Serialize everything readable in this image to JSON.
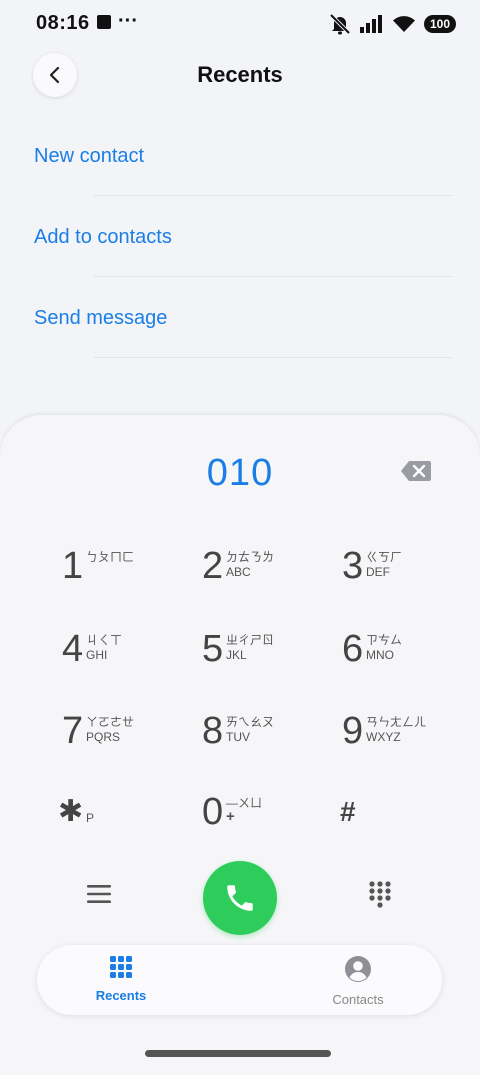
{
  "status_bar": {
    "time": "08:16",
    "more": "···",
    "battery": "100"
  },
  "header": {
    "title": "Recents"
  },
  "actions": [
    {
      "label": "New contact"
    },
    {
      "label": "Add to contacts"
    },
    {
      "label": "Send message"
    }
  ],
  "dialer": {
    "number": "010",
    "keys": [
      {
        "digit": "1",
        "zhuyin": "ㄅㄆㄇㄈ",
        "letters": ""
      },
      {
        "digit": "2",
        "zhuyin": "ㄉㄊㄋㄌ",
        "letters": "ABC"
      },
      {
        "digit": "3",
        "zhuyin": "ㄍㄎㄏ",
        "letters": "DEF"
      },
      {
        "digit": "4",
        "zhuyin": "ㄐㄑㄒ",
        "letters": "GHI"
      },
      {
        "digit": "5",
        "zhuyin": "ㄓㄔㄕㄖ",
        "letters": "JKL"
      },
      {
        "digit": "6",
        "zhuyin": "ㄗㄘㄙ",
        "letters": "MNO"
      },
      {
        "digit": "7",
        "zhuyin": "ㄚㄛㄜㄝ",
        "letters": "PQRS"
      },
      {
        "digit": "8",
        "zhuyin": "ㄞㄟㄠㄡ",
        "letters": "TUV"
      },
      {
        "digit": "9",
        "zhuyin": "ㄢㄣㄤㄥㄦ",
        "letters": "WXYZ"
      },
      {
        "digit": "✱",
        "zhuyin": "",
        "letters": "P"
      },
      {
        "digit": "0",
        "zhuyin": "—ㄨㄩ",
        "letters": "+"
      },
      {
        "digit": "#",
        "zhuyin": "",
        "letters": ""
      }
    ]
  },
  "bottom_nav": {
    "items": [
      {
        "label": "Recents",
        "active": true
      },
      {
        "label": "Contacts",
        "active": false
      }
    ]
  },
  "colors": {
    "accent": "#1a7ee6",
    "call": "#2ecc5a",
    "inactive": "#888888"
  }
}
